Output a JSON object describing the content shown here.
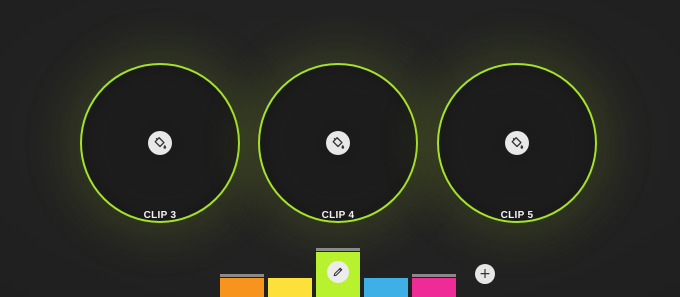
{
  "clips": [
    {
      "label": "CLIP 3",
      "icon": "paint-bucket-icon"
    },
    {
      "label": "CLIP 4",
      "icon": "paint-bucket-icon"
    },
    {
      "label": "CLIP 5",
      "icon": "paint-bucket-icon"
    }
  ],
  "palette": {
    "swatches": [
      {
        "color": "#f7941d",
        "has_cap": true,
        "selected": false
      },
      {
        "color": "#fde13a",
        "has_cap": false,
        "selected": false
      },
      {
        "color": "#b8f22e",
        "has_cap": true,
        "selected": true,
        "icon": "pencil-icon"
      },
      {
        "color": "#3fb0e6",
        "has_cap": false,
        "selected": false
      },
      {
        "color": "#ee2b97",
        "has_cap": true,
        "selected": false
      }
    ],
    "add_icon": "plus-icon",
    "add_symbol": "+"
  },
  "accent_color": "#a5e22a",
  "background_color": "#232323"
}
